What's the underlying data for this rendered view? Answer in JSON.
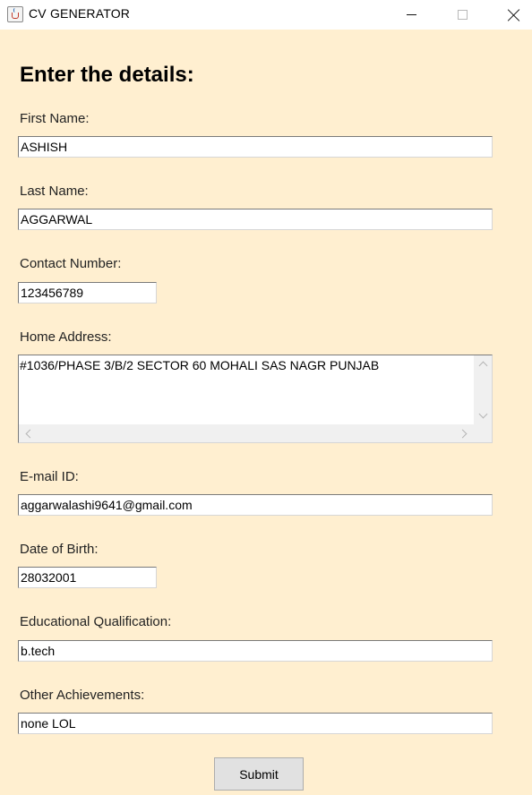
{
  "window": {
    "title": "CV GENERATOR",
    "icon": "java-cup-icon"
  },
  "form": {
    "heading": "Enter the details:",
    "first_name": {
      "label": "First Name:",
      "value": "ASHISH"
    },
    "last_name": {
      "label": "Last Name:",
      "value": "AGGARWAL"
    },
    "contact": {
      "label": "Contact Number:",
      "value": "123456789"
    },
    "address": {
      "label": "Home Address:",
      "value": "#1036/PHASE 3/B/2 SECTOR 60 MOHALI SAS NAGR PUNJAB"
    },
    "email": {
      "label": "E-mail ID:",
      "value": "aggarwalashi9641@gmail.com"
    },
    "dob": {
      "label": "Date of Birth:",
      "value": "28032001"
    },
    "education": {
      "label": "Educational Qualification:",
      "value": "b.tech"
    },
    "achievements": {
      "label": "Other Achievements:",
      "value": "none LOL"
    },
    "submit_label": "Submit"
  },
  "colors": {
    "background": "#ffefd0",
    "field": "#ffffff",
    "button": "#e1e1e1"
  }
}
